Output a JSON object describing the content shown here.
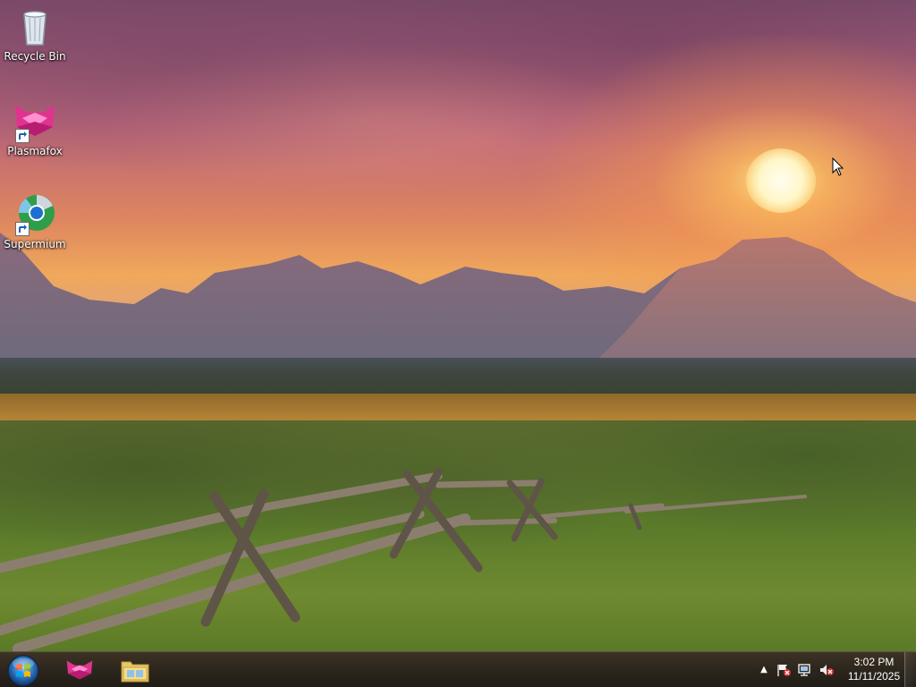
{
  "desktop": {
    "icons": [
      {
        "label": "Recycle Bin",
        "icon": "recycle-bin-icon"
      },
      {
        "label": "Plasmafox",
        "icon": "plasmafox-icon"
      },
      {
        "label": "Supermium",
        "icon": "supermium-icon"
      }
    ]
  },
  "taskbar": {
    "start_icon": "windows-start-icon",
    "pinned": [
      {
        "icon": "plasmafox-icon"
      },
      {
        "icon": "file-explorer-icon"
      }
    ],
    "tray": {
      "expand_glyph": "▲",
      "icons": [
        "action-center-flag-icon",
        "network-icon",
        "volume-muted-icon"
      ]
    },
    "clock": {
      "time": "3:02 PM",
      "date": "11/11/2025"
    }
  },
  "colors": {
    "plasma_pink": "#e0338f",
    "taskbar": "#2c201e"
  }
}
